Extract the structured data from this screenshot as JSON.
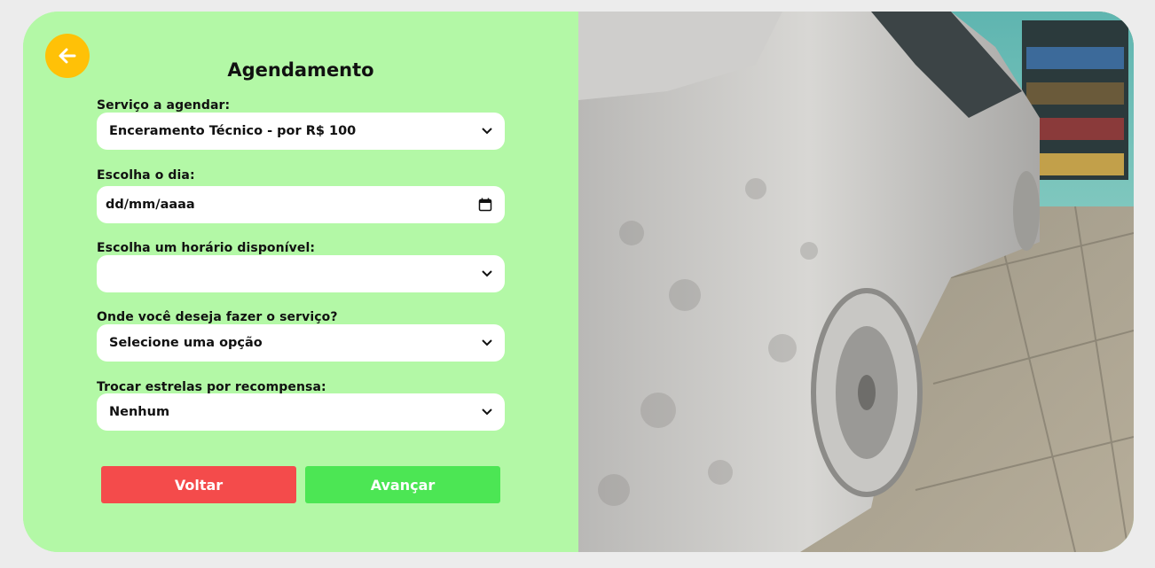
{
  "header": {
    "title": "Agendamento",
    "back_icon": "arrow-left-icon"
  },
  "form": {
    "servico": {
      "label": "Serviço a agendar:",
      "value": "Enceramento Técnico - por R$ 100"
    },
    "dia": {
      "label": "Escolha o dia:",
      "value": "dd/mm/aaaa"
    },
    "horario": {
      "label": "Escolha um horário disponível:",
      "value": ""
    },
    "local": {
      "label": "Onde você deseja fazer o serviço?",
      "value": "Selecione uma opção"
    },
    "estrelas": {
      "label": "Trocar estrelas por recompensa:",
      "value": "Nenhum"
    }
  },
  "buttons": {
    "voltar": "Voltar",
    "avancar": "Avançar"
  },
  "colors": {
    "panel": "#b3f8a6",
    "back_circle": "#ffc107",
    "voltar": "#f44b4b",
    "avancar": "#4ce654"
  },
  "image": {
    "icon": "car-foam-wash-photo"
  }
}
